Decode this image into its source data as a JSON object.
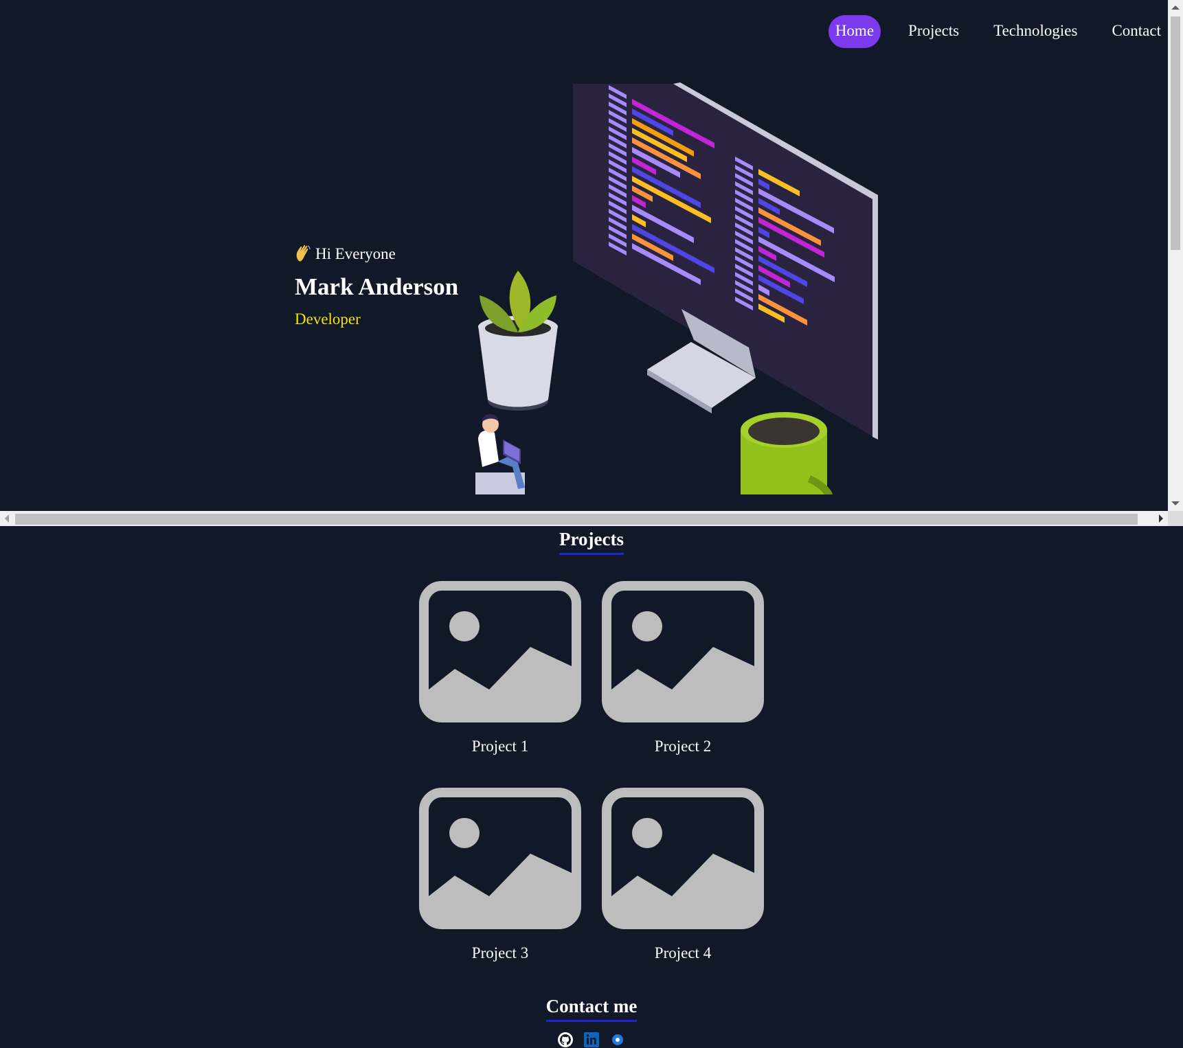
{
  "nav": {
    "items": [
      {
        "label": "Home",
        "active": true
      },
      {
        "label": "Projects",
        "active": false
      },
      {
        "label": "Technologies",
        "active": false
      },
      {
        "label": "Contact",
        "active": false
      }
    ]
  },
  "hero": {
    "greeting": "Hi Everyone",
    "name": "Mark Anderson",
    "role": "Developer"
  },
  "projects": {
    "title": "Projects",
    "items": [
      {
        "label": "Project 1"
      },
      {
        "label": "Project 2"
      },
      {
        "label": "Project 3"
      },
      {
        "label": "Project 4"
      }
    ]
  },
  "contact": {
    "title": "Contact me",
    "icons": [
      "github-icon",
      "linkedin-icon",
      "other-link-icon"
    ]
  },
  "colors": {
    "background": "#111827",
    "accent": "#7c3aed",
    "role": "#f5e012",
    "underline": "#1d26d6",
    "placeholder": "#bdbdbd"
  }
}
